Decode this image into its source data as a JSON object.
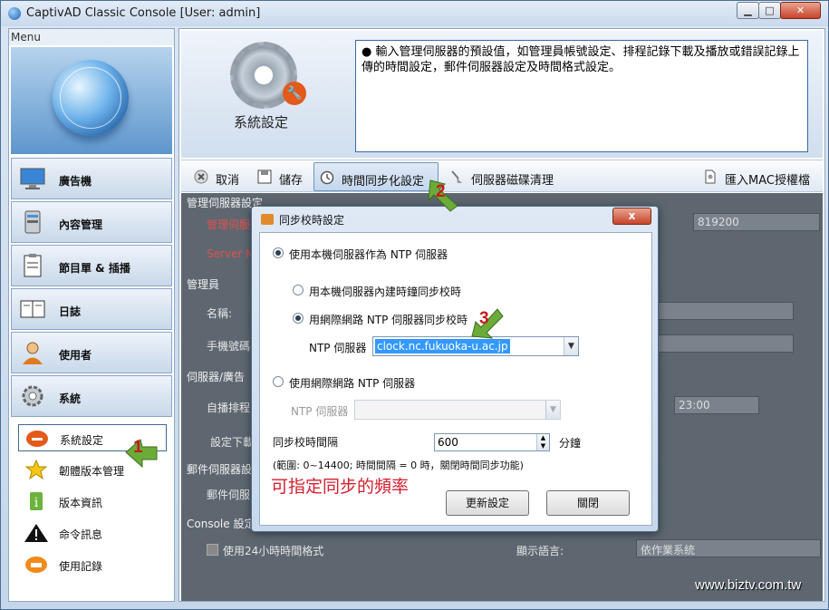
{
  "window": {
    "title": "CaptivAD Classic Console [User: admin]"
  },
  "menu": {
    "header": "Menu",
    "items": [
      {
        "label": "廣告機",
        "icon": "monitor-icon"
      },
      {
        "label": "內容管理",
        "icon": "server-icon"
      },
      {
        "label": "節目單 & 插播",
        "icon": "clipboard-icon"
      },
      {
        "label": "日誌",
        "icon": "book-icon"
      },
      {
        "label": "使用者",
        "icon": "user-icon"
      },
      {
        "label": "系統",
        "icon": "gear-icon"
      }
    ],
    "subitems": [
      {
        "label": "系統設定",
        "icon": "wrench-icon"
      },
      {
        "label": "韌體版本管理",
        "icon": "star-icon"
      },
      {
        "label": "版本資訊",
        "icon": "info-icon"
      },
      {
        "label": "命令訊息",
        "icon": "warning-icon"
      },
      {
        "label": "使用記錄",
        "icon": "hand-icon"
      }
    ]
  },
  "header": {
    "title": "系統設定",
    "description": "● 輸入管理伺服器的預設值，如管理員帳號設定、排程記錄下載及播放或錯誤記錄上傳的時間設定，郵件伺服器設定及時間格式設定。"
  },
  "toolbar": {
    "cancel": "取消",
    "save": "儲存",
    "time_sync": "時間同步化設定",
    "disk_clean": "伺服器磁碟清理",
    "import_mac": "匯入MAC授權檔"
  },
  "form": {
    "sec_mgmt": "管理伺服器設定",
    "mgmt_server": "管理伺服",
    "server_name": "Server Na",
    "port_value": "819200",
    "sec_admin": "管理員",
    "name": "名稱:",
    "phone": "手機號碼",
    "sec_server": "伺服器/廣告",
    "auto_schedule": "自播排程",
    "time_value": "23:00",
    "set_download": "設定下載",
    "sec_mail": "郵件伺服器設",
    "mail_server": "郵件伺服",
    "sec_console": "Console 設定",
    "use_24h": "使用24小時時間格式",
    "display_lang": "顯示語言:",
    "lang_value": "依作業系統"
  },
  "dialog": {
    "title": "同步校時設定",
    "close_label": "x",
    "opt_local_ntp": "使用本機伺服器作為 NTP 伺服器",
    "opt_builtin_clock": "用本機伺服器內建時鐘同步校時",
    "opt_internet_ntp": "用網際網路 NTP 伺服器同步校時",
    "ntp_label": "NTP 伺服器",
    "ntp_value": "clock.nc.fukuoka-u.ac.jp",
    "opt_use_internet": "使用網際網路 NTP 伺服器",
    "ntp_label2": "NTP 伺服器",
    "interval_label": "同步校時間隔",
    "interval_value": "600",
    "interval_unit": "分鐘",
    "range_note": "(範圍: 0~14400; 時間間隔 = 0 時，關閉時間同步功能)",
    "annotation": "可指定同步的頻率",
    "update_btn": "更新設定",
    "close_btn": "關閉"
  },
  "markers": [
    "1",
    "2",
    "3"
  ],
  "watermark": "www.biztv.com.tw"
}
